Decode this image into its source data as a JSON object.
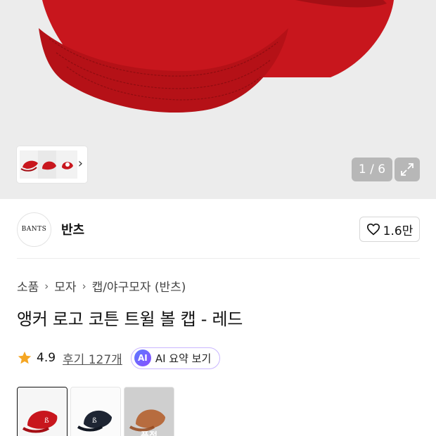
{
  "gallery": {
    "counter": "1 / 6",
    "thumb_icons": [
      "cap-thumbnail",
      "cap-thumbnail",
      "cap-thumbnail"
    ],
    "colors": {
      "background": "#ececec",
      "cap_red": "#c8161d"
    }
  },
  "brand": {
    "logo_text": "BANTS",
    "name": "반츠",
    "likes": "1.6만"
  },
  "breadcrumb": [
    "소품",
    "모자",
    "캡/야구모자 (반츠)"
  ],
  "product": {
    "title": "앵커 로고 코튼 트윌 볼 캡 - 레드",
    "rating": "4.9",
    "reviews": "후기 127개",
    "ai_badge": "AI",
    "ai_summary": "AI 요약 보기"
  },
  "options": [
    {
      "color": "#c8161d",
      "selected": true,
      "tag": ""
    },
    {
      "color": "#1e2533",
      "selected": false,
      "tag": ""
    },
    {
      "color": "#b35a26",
      "selected": false,
      "tag": "품절"
    }
  ],
  "colors": {
    "accent_ai": "#7a5cff",
    "star": "#f5a623"
  }
}
